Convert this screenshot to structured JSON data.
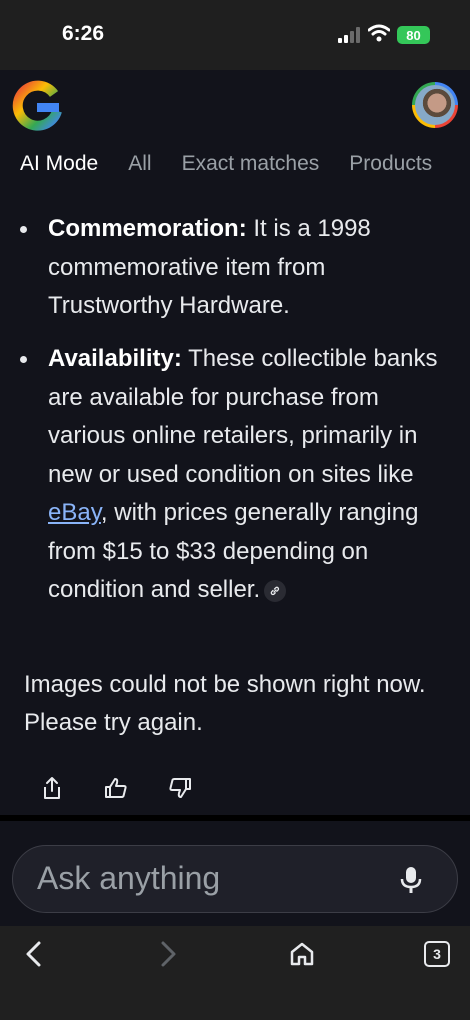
{
  "status_bar": {
    "time": "6:26",
    "battery": "80"
  },
  "tabs": [
    "AI Mode",
    "All",
    "Exact matches",
    "Products"
  ],
  "bullets": [
    {
      "label": "Commemoration:",
      "text": " It is a 1998 commemorative item from Trustworthy Hardware."
    },
    {
      "label": "Availability:",
      "text_before": " These collectible banks are available for purchase from various online retailers, primarily in new or used condition on sites like ",
      "link": "eBay",
      "text_after": ", with prices generally ranging from $15 to $33 depending on condition and seller."
    }
  ],
  "message": "Images could not be shown right now. Please try again.",
  "ask": {
    "placeholder": "Ask anything"
  },
  "nav": {
    "tab_count": "3"
  },
  "icons": {
    "cite": "link-icon",
    "share": "share-icon",
    "like": "thumbs-up-icon",
    "dislike": "thumbs-down-icon",
    "mic": "mic-icon"
  },
  "colors": {
    "background": "#12131b",
    "link": "#8ab4f8",
    "battery": "#34c759"
  }
}
